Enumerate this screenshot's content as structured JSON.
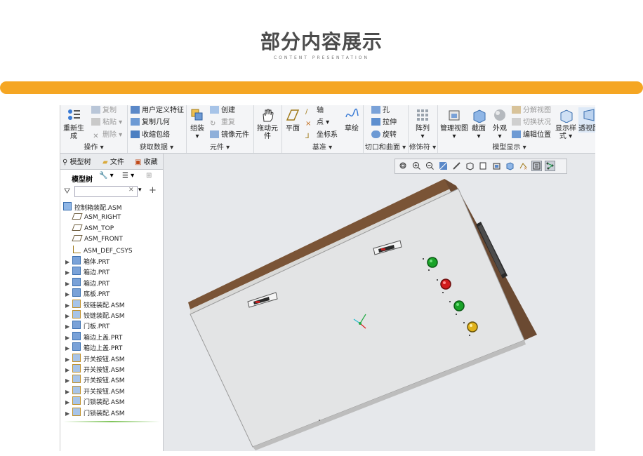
{
  "header": {
    "title": "部分内容展示",
    "subtitle": "CONTENT PRESENTATION"
  },
  "ribbon": {
    "ops": {
      "regenerate": "重新生成",
      "copy": "复制",
      "paste": "粘贴",
      "delete": "删除",
      "label": "操作"
    },
    "getdata": {
      "udf": "用户定义特征",
      "copygeom": "复制几何",
      "shrinkwrap": "收缩包络",
      "label": "获取数据"
    },
    "component": {
      "assemble": "组装",
      "create": "创建",
      "repeat": "重复",
      "mirror": "镜像元件",
      "label": "元件"
    },
    "drag": {
      "label": "拖动元件"
    },
    "datum": {
      "plane": "平面",
      "axis": "轴",
      "point": "点",
      "csys": "坐标系",
      "sketch": "草绘",
      "label": "基准"
    },
    "cut": {
      "hole": "孔",
      "extrude": "拉伸",
      "revolve": "旋转",
      "label": "切口和曲面"
    },
    "modifier": {
      "pattern": "阵列",
      "label": "修饰符"
    },
    "modeldisplay": {
      "manageviews": "管理视图",
      "section": "截面",
      "appearance": "外观",
      "explode": "分解视图",
      "togglestate": "切换状况",
      "editposition": "编辑位置",
      "displaystyle": "显示样式",
      "perspective": "透视图",
      "label": "模型显示"
    }
  },
  "tree": {
    "tabs": {
      "modeltree": "模型树",
      "folder": "文件",
      "favorites": "收藏"
    },
    "toolbar_label": "模型树",
    "filter_placeholder": "",
    "root": "控制箱装配.ASM",
    "datums": [
      "ASM_RIGHT",
      "ASM_TOP",
      "ASM_FRONT",
      "ASM_DEF_CSYS"
    ],
    "items": [
      "箱体.PRT",
      "箱边.PRT",
      "箱边.PRT",
      "底板.PRT",
      "铰链装配.ASM",
      "铰链装配.ASM",
      "门板.PRT",
      "箱边上盖.PRT",
      "箱边上盖.PRT",
      "开关按钮.ASM",
      "开关按钮.ASM",
      "开关按钮.ASM",
      "开关按钮.ASM",
      "门锁装配.ASM",
      "门锁装配.ASM"
    ]
  },
  "colors": {
    "accent_bar": "#f5a623",
    "box_side": "#6b4a32",
    "button_green": "#1aa329",
    "button_red": "#d11b1b",
    "button_yellow": "#e0b21a"
  }
}
